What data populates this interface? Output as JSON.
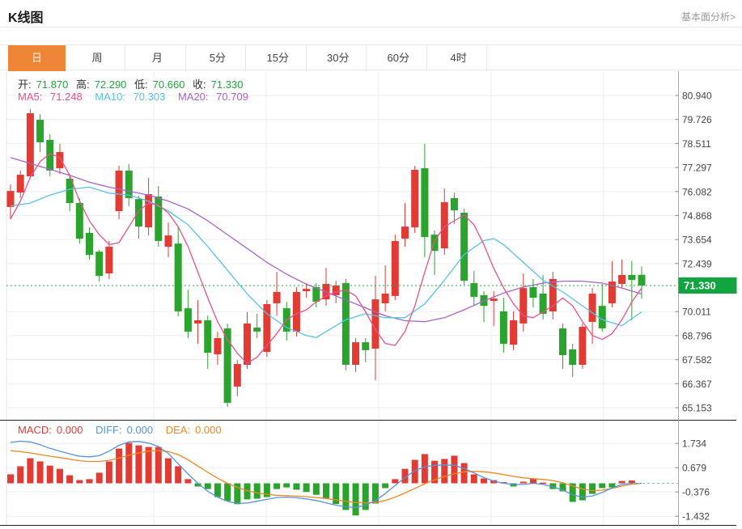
{
  "header": {
    "title": "K线图",
    "link": "基本面分析>"
  },
  "tabs": {
    "items": [
      "日",
      "周",
      "月",
      "5分",
      "15分",
      "30分",
      "60分",
      "4时"
    ],
    "selected": "日"
  },
  "legend": {
    "ohlc": [
      {
        "label": "开:",
        "value": "71.870"
      },
      {
        "label": "高:",
        "value": "72.290"
      },
      {
        "label": "低:",
        "value": "70.660"
      },
      {
        "label": "收:",
        "value": "71.330"
      }
    ],
    "ma": [
      {
        "label": "MA5:",
        "value": "71.248"
      },
      {
        "label": "MA10:",
        "value": "70.303"
      },
      {
        "label": "MA20:",
        "value": "70.709"
      }
    ],
    "macd": [
      {
        "label": "MACD:",
        "value": "0.000"
      },
      {
        "label": "DIFF:",
        "value": "0.000"
      },
      {
        "label": "DEA:",
        "value": "0.000"
      }
    ]
  },
  "chart_data": {
    "type": "candlestick",
    "title": "K线图 daily candlestick with MACD",
    "price_axis": {
      "tick_labels": [
        "80.940",
        "79.726",
        "78.511",
        "77.297",
        "76.082",
        "74.868",
        "73.654",
        "72.439",
        "70.011",
        "68.796",
        "67.582",
        "66.367",
        "65.153"
      ],
      "current_price_label": "71.330",
      "current_price": 71.33
    },
    "macd_axis": {
      "tick_labels": [
        "1.734",
        "0.679",
        "-0.376",
        "-1.432"
      ],
      "tick_values": [
        1.734,
        0.679,
        -0.376,
        -1.432
      ]
    },
    "candles_ohlc": [
      [
        75.3,
        76.44,
        74.68,
        76.11
      ],
      [
        76.03,
        77.14,
        75.75,
        76.93
      ],
      [
        76.85,
        80.24,
        76.73,
        80.04
      ],
      [
        79.71,
        80.0,
        78.08,
        78.57
      ],
      [
        78.69,
        78.98,
        76.85,
        77.14
      ],
      [
        77.26,
        78.49,
        76.97,
        78.08
      ],
      [
        76.73,
        76.97,
        75.09,
        75.5
      ],
      [
        75.5,
        75.75,
        73.45,
        73.7
      ],
      [
        73.99,
        74.27,
        72.64,
        72.88
      ],
      [
        73.04,
        73.13,
        71.53,
        71.82
      ],
      [
        71.94,
        73.58,
        71.66,
        73.29
      ],
      [
        75.09,
        77.38,
        74.68,
        77.14
      ],
      [
        77.14,
        77.47,
        75.34,
        75.75
      ],
      [
        75.7,
        75.87,
        73.7,
        74.31
      ],
      [
        74.27,
        76.77,
        73.86,
        75.95
      ],
      [
        75.83,
        76.36,
        73.29,
        73.58
      ],
      [
        73.29,
        74.52,
        72.76,
        73.86
      ],
      [
        73.45,
        74.31,
        69.77,
        70.02
      ],
      [
        70.18,
        71.12,
        68.67,
        69.0
      ],
      [
        69.41,
        70.59,
        68.38,
        69.57
      ],
      [
        69.57,
        69.81,
        67.11,
        67.93
      ],
      [
        67.85,
        69.0,
        67.32,
        68.67
      ],
      [
        69.16,
        69.41,
        65.19,
        65.4
      ],
      [
        66.22,
        67.56,
        65.73,
        67.36
      ],
      [
        67.32,
        69.98,
        67.11,
        69.41
      ],
      [
        69.2,
        69.9,
        68.67,
        69.0
      ],
      [
        67.97,
        70.59,
        67.73,
        70.39
      ],
      [
        70.43,
        72.02,
        69.81,
        71.0
      ],
      [
        70.18,
        70.51,
        68.55,
        69.0
      ],
      [
        69.0,
        71.25,
        68.75,
        71.0
      ],
      [
        71.04,
        71.45,
        70.71,
        71.16
      ],
      [
        71.25,
        71.45,
        70.22,
        70.51
      ],
      [
        70.63,
        72.23,
        70.3,
        71.41
      ],
      [
        70.84,
        71.57,
        70.43,
        71.33
      ],
      [
        71.45,
        71.66,
        67.03,
        67.32
      ],
      [
        67.32,
        68.67,
        66.95,
        68.46
      ],
      [
        68.46,
        68.67,
        67.44,
        68.06
      ],
      [
        68.14,
        71.82,
        66.54,
        70.63
      ],
      [
        70.43,
        72.35,
        70.02,
        70.92
      ],
      [
        70.8,
        73.9,
        70.59,
        73.58
      ],
      [
        73.7,
        75.5,
        73.29,
        74.31
      ],
      [
        74.27,
        77.38,
        73.99,
        77.18
      ],
      [
        77.26,
        78.49,
        72.76,
        73.78
      ],
      [
        73.9,
        74.11,
        71.86,
        73.08
      ],
      [
        73.21,
        76.24,
        72.88,
        75.54
      ],
      [
        75.75,
        76.03,
        74.44,
        75.13
      ],
      [
        75.01,
        75.21,
        71.37,
        71.57
      ],
      [
        71.45,
        72.06,
        70.35,
        70.76
      ],
      [
        70.84,
        71.04,
        69.49,
        70.3
      ],
      [
        70.55,
        71.04,
        69.28,
        70.67
      ],
      [
        70.02,
        70.71,
        67.93,
        68.38
      ],
      [
        68.34,
        70.02,
        68.06,
        69.57
      ],
      [
        69.41,
        71.94,
        69.0,
        71.2
      ],
      [
        71.25,
        71.66,
        70.22,
        70.71
      ],
      [
        70.92,
        71.86,
        69.61,
        69.9
      ],
      [
        70.02,
        72.02,
        69.61,
        71.66
      ],
      [
        69.16,
        69.41,
        67.11,
        67.81
      ],
      [
        68.1,
        68.38,
        66.71,
        67.32
      ],
      [
        67.32,
        69.41,
        67.11,
        69.24
      ],
      [
        69.49,
        71.2,
        68.38,
        70.92
      ],
      [
        70.3,
        71.41,
        69.0,
        69.16
      ],
      [
        70.43,
        72.56,
        70.22,
        71.53
      ],
      [
        71.41,
        72.64,
        71.2,
        71.86
      ],
      [
        71.86,
        72.56,
        69.57,
        71.61
      ],
      [
        71.87,
        72.29,
        70.66,
        71.33
      ]
    ],
    "ma5_points": [
      [
        0,
        74.7
      ],
      [
        1,
        75.6
      ],
      [
        2,
        76.8
      ],
      [
        3,
        77.6
      ],
      [
        4,
        78.0
      ],
      [
        5,
        77.8
      ],
      [
        6,
        76.9
      ],
      [
        7,
        75.6
      ],
      [
        8,
        74.6
      ],
      [
        9,
        73.9
      ],
      [
        10,
        73.4
      ],
      [
        11,
        73.5
      ],
      [
        12,
        74.3
      ],
      [
        13,
        75.1
      ],
      [
        14,
        75.5
      ],
      [
        15,
        75.4
      ],
      [
        16,
        75.0
      ],
      [
        17,
        74.3
      ],
      [
        18,
        73.3
      ],
      [
        19,
        72.0
      ],
      [
        20,
        70.7
      ],
      [
        21,
        69.5
      ],
      [
        22,
        68.6
      ],
      [
        23,
        67.9
      ],
      [
        24,
        67.4
      ],
      [
        25,
        67.7
      ],
      [
        26,
        68.3
      ],
      [
        27,
        68.9
      ],
      [
        28,
        69.6
      ],
      [
        29,
        69.9
      ],
      [
        30,
        70.1
      ],
      [
        31,
        70.5
      ],
      [
        32,
        70.8
      ],
      [
        33,
        71.0
      ],
      [
        34,
        71.1
      ],
      [
        35,
        70.8
      ],
      [
        36,
        70.0
      ],
      [
        37,
        69.1
      ],
      [
        38,
        68.4
      ],
      [
        39,
        68.3
      ],
      [
        40,
        69.0
      ],
      [
        41,
        70.3
      ],
      [
        42,
        72.0
      ],
      [
        43,
        73.6
      ],
      [
        44,
        74.3
      ],
      [
        45,
        74.6
      ],
      [
        46,
        74.9
      ],
      [
        47,
        74.4
      ],
      [
        48,
        73.4
      ],
      [
        49,
        72.2
      ],
      [
        50,
        71.2
      ],
      [
        51,
        70.4
      ],
      [
        52,
        69.8
      ],
      [
        53,
        69.7
      ],
      [
        54,
        70.0
      ],
      [
        55,
        70.3
      ],
      [
        56,
        70.7
      ],
      [
        57,
        70.3
      ],
      [
        58,
        69.5
      ],
      [
        59,
        68.8
      ],
      [
        60,
        68.6
      ],
      [
        61,
        68.9
      ],
      [
        62,
        69.6
      ],
      [
        63,
        70.5
      ],
      [
        64,
        71.2
      ]
    ],
    "ma10_points": [
      [
        0,
        75.35
      ],
      [
        2,
        75.5
      ],
      [
        4,
        75.9
      ],
      [
        6,
        76.2
      ],
      [
        8,
        76.3
      ],
      [
        10,
        76.0
      ],
      [
        12,
        75.9
      ],
      [
        14,
        75.6
      ],
      [
        16,
        75.1
      ],
      [
        18,
        74.4
      ],
      [
        20,
        73.3
      ],
      [
        22,
        72.1
      ],
      [
        24,
        70.9
      ],
      [
        26,
        69.9
      ],
      [
        28,
        69.2
      ],
      [
        30,
        68.8
      ],
      [
        31,
        68.7
      ],
      [
        32,
        69.0
      ],
      [
        34,
        69.6
      ],
      [
        36,
        69.9
      ],
      [
        38,
        69.7
      ],
      [
        40,
        69.7
      ],
      [
        42,
        70.4
      ],
      [
        44,
        71.6
      ],
      [
        46,
        72.9
      ],
      [
        48,
        73.6
      ],
      [
        49,
        73.7
      ],
      [
        50,
        73.4
      ],
      [
        52,
        72.5
      ],
      [
        54,
        71.6
      ],
      [
        56,
        71.0
      ],
      [
        58,
        70.3
      ],
      [
        60,
        69.6
      ],
      [
        62,
        69.3
      ],
      [
        64,
        70.0
      ]
    ],
    "ma20_points": [
      [
        0,
        77.8
      ],
      [
        2,
        77.5
      ],
      [
        4,
        77.2
      ],
      [
        6,
        76.9
      ],
      [
        8,
        76.55
      ],
      [
        10,
        76.3
      ],
      [
        12,
        76.1
      ],
      [
        14,
        75.9
      ],
      [
        16,
        75.6
      ],
      [
        18,
        75.2
      ],
      [
        20,
        74.6
      ],
      [
        22,
        73.9
      ],
      [
        24,
        73.2
      ],
      [
        26,
        72.5
      ],
      [
        28,
        71.9
      ],
      [
        30,
        71.4
      ],
      [
        32,
        71.0
      ],
      [
        34,
        70.6
      ],
      [
        36,
        70.2
      ],
      [
        38,
        69.8
      ],
      [
        40,
        69.55
      ],
      [
        42,
        69.5
      ],
      [
        44,
        69.7
      ],
      [
        46,
        70.1
      ],
      [
        48,
        70.55
      ],
      [
        50,
        70.95
      ],
      [
        52,
        71.25
      ],
      [
        54,
        71.45
      ],
      [
        56,
        71.55
      ],
      [
        58,
        71.55
      ],
      [
        60,
        71.45
      ],
      [
        62,
        71.2
      ],
      [
        64,
        70.9
      ]
    ],
    "macd_hist": [
      0.39,
      0.74,
      1.09,
      0.95,
      0.77,
      0.63,
      0.35,
      0.14,
      0.18,
      0.46,
      0.95,
      1.51,
      1.76,
      1.65,
      1.58,
      1.58,
      1.09,
      0.74,
      0.18,
      -0.14,
      -0.25,
      -0.6,
      -0.77,
      -0.91,
      -0.7,
      -0.67,
      -0.6,
      -0.25,
      -0.18,
      -0.28,
      -0.38,
      -0.5,
      -0.65,
      -0.9,
      -1.16,
      -1.4,
      -1.16,
      -0.88,
      -0.21,
      0.18,
      0.63,
      1.02,
      1.27,
      0.98,
      1.06,
      1.2,
      0.88,
      0.39,
      0.21,
      0.14,
      0.05,
      -0.14,
      0.07,
      0.21,
      0.03,
      -0.25,
      -0.35,
      -0.81,
      -0.74,
      -0.46,
      -0.21,
      -0.18,
      0.1,
      0.12,
      0.0
    ],
    "diff_line": [
      1.78,
      1.83,
      1.8,
      1.68,
      1.52,
      1.4,
      1.28,
      1.18,
      1.15,
      1.2,
      1.4,
      1.65,
      1.8,
      1.82,
      1.75,
      1.6,
      1.3,
      0.85,
      0.4,
      0.0,
      -0.35,
      -0.6,
      -0.78,
      -0.88,
      -0.86,
      -0.78,
      -0.7,
      -0.62,
      -0.6,
      -0.63,
      -0.68,
      -0.75,
      -0.85,
      -0.95,
      -1.02,
      -1.05,
      -0.95,
      -0.75,
      -0.45,
      -0.1,
      0.25,
      0.55,
      0.72,
      0.78,
      0.8,
      0.78,
      0.65,
      0.45,
      0.25,
      0.1,
      0.0,
      -0.05,
      -0.05,
      0.0,
      -0.05,
      -0.15,
      -0.3,
      -0.5,
      -0.6,
      -0.55,
      -0.4,
      -0.2,
      -0.05,
      0.0,
      0.0
    ],
    "dea_line": [
      1.42,
      1.38,
      1.32,
      1.25,
      1.18,
      1.12,
      1.05,
      0.98,
      0.95,
      0.95,
      1.0,
      1.1,
      1.22,
      1.32,
      1.4,
      1.42,
      1.38,
      1.25,
      1.02,
      0.75,
      0.48,
      0.22,
      0.0,
      -0.18,
      -0.32,
      -0.42,
      -0.48,
      -0.52,
      -0.54,
      -0.56,
      -0.58,
      -0.62,
      -0.66,
      -0.72,
      -0.78,
      -0.83,
      -0.85,
      -0.83,
      -0.75,
      -0.6,
      -0.42,
      -0.22,
      -0.02,
      0.15,
      0.3,
      0.42,
      0.5,
      0.52,
      0.5,
      0.45,
      0.38,
      0.3,
      0.24,
      0.2,
      0.17,
      0.12,
      0.02,
      -0.12,
      -0.25,
      -0.32,
      -0.3,
      -0.22,
      -0.12,
      -0.04,
      0.0
    ],
    "colors": {
      "up": "#e23b33",
      "down": "#2aa42d",
      "ma5": "#ec4f8c",
      "ma10": "#54c3e6",
      "ma20": "#a962c9",
      "diff": "#5592dc",
      "dea": "#ee8822",
      "accent": "#ee8435",
      "price_tag": "#12a53f",
      "value_green": "#21a53c",
      "current_line": "#2aa44a",
      "grid": "#ededed",
      "axis_line": "#aaaaaa",
      "axis_text": "#444444"
    }
  }
}
